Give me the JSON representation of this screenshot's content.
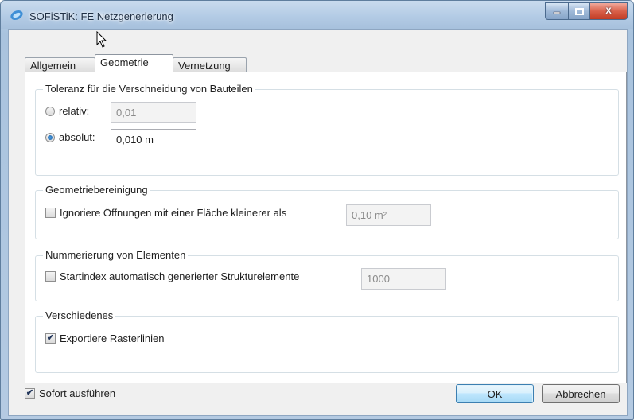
{
  "window": {
    "title": "SOFiSTiK: FE Netzgenerierung",
    "buttons": {
      "minimize": "minimize-icon",
      "maximize": "maximize-icon",
      "close_glyph": "X"
    }
  },
  "tabs": [
    {
      "label": "Allgemein",
      "active": false
    },
    {
      "label": "Geometrie",
      "active": true
    },
    {
      "label": "Vernetzung",
      "active": false
    }
  ],
  "groups": {
    "tolerance": {
      "title": "Toleranz für die Verschneidung von Bauteilen",
      "relative_label": "relativ:",
      "relative_value": "0,01",
      "relative_selected": false,
      "absolute_label": "absolut:",
      "absolute_value": "0,010 m",
      "absolute_selected": true
    },
    "cleanup": {
      "title": "Geometriebereinigung",
      "ignore_label": "Ignoriere Öffnungen mit einer Fläche kleinerer als",
      "ignore_checked": false,
      "area_value": "0,10 m²"
    },
    "numbering": {
      "title": "Nummerierung von Elementen",
      "startindex_label": "Startindex automatisch generierter Strukturelemente",
      "startindex_checked": false,
      "startindex_value": "1000"
    },
    "misc": {
      "title": "Verschiedenes",
      "gridlines_label": "Exportiere Rasterlinien",
      "gridlines_checked": true
    }
  },
  "footer": {
    "run_now_label": "Sofort ausführen",
    "run_now_checked": true,
    "ok_label": "OK",
    "cancel_label": "Abbrechen"
  },
  "colors": {
    "accent": "#3c7fb1",
    "title_bar": "#b3cbe5",
    "close_button": "#c13c24"
  }
}
